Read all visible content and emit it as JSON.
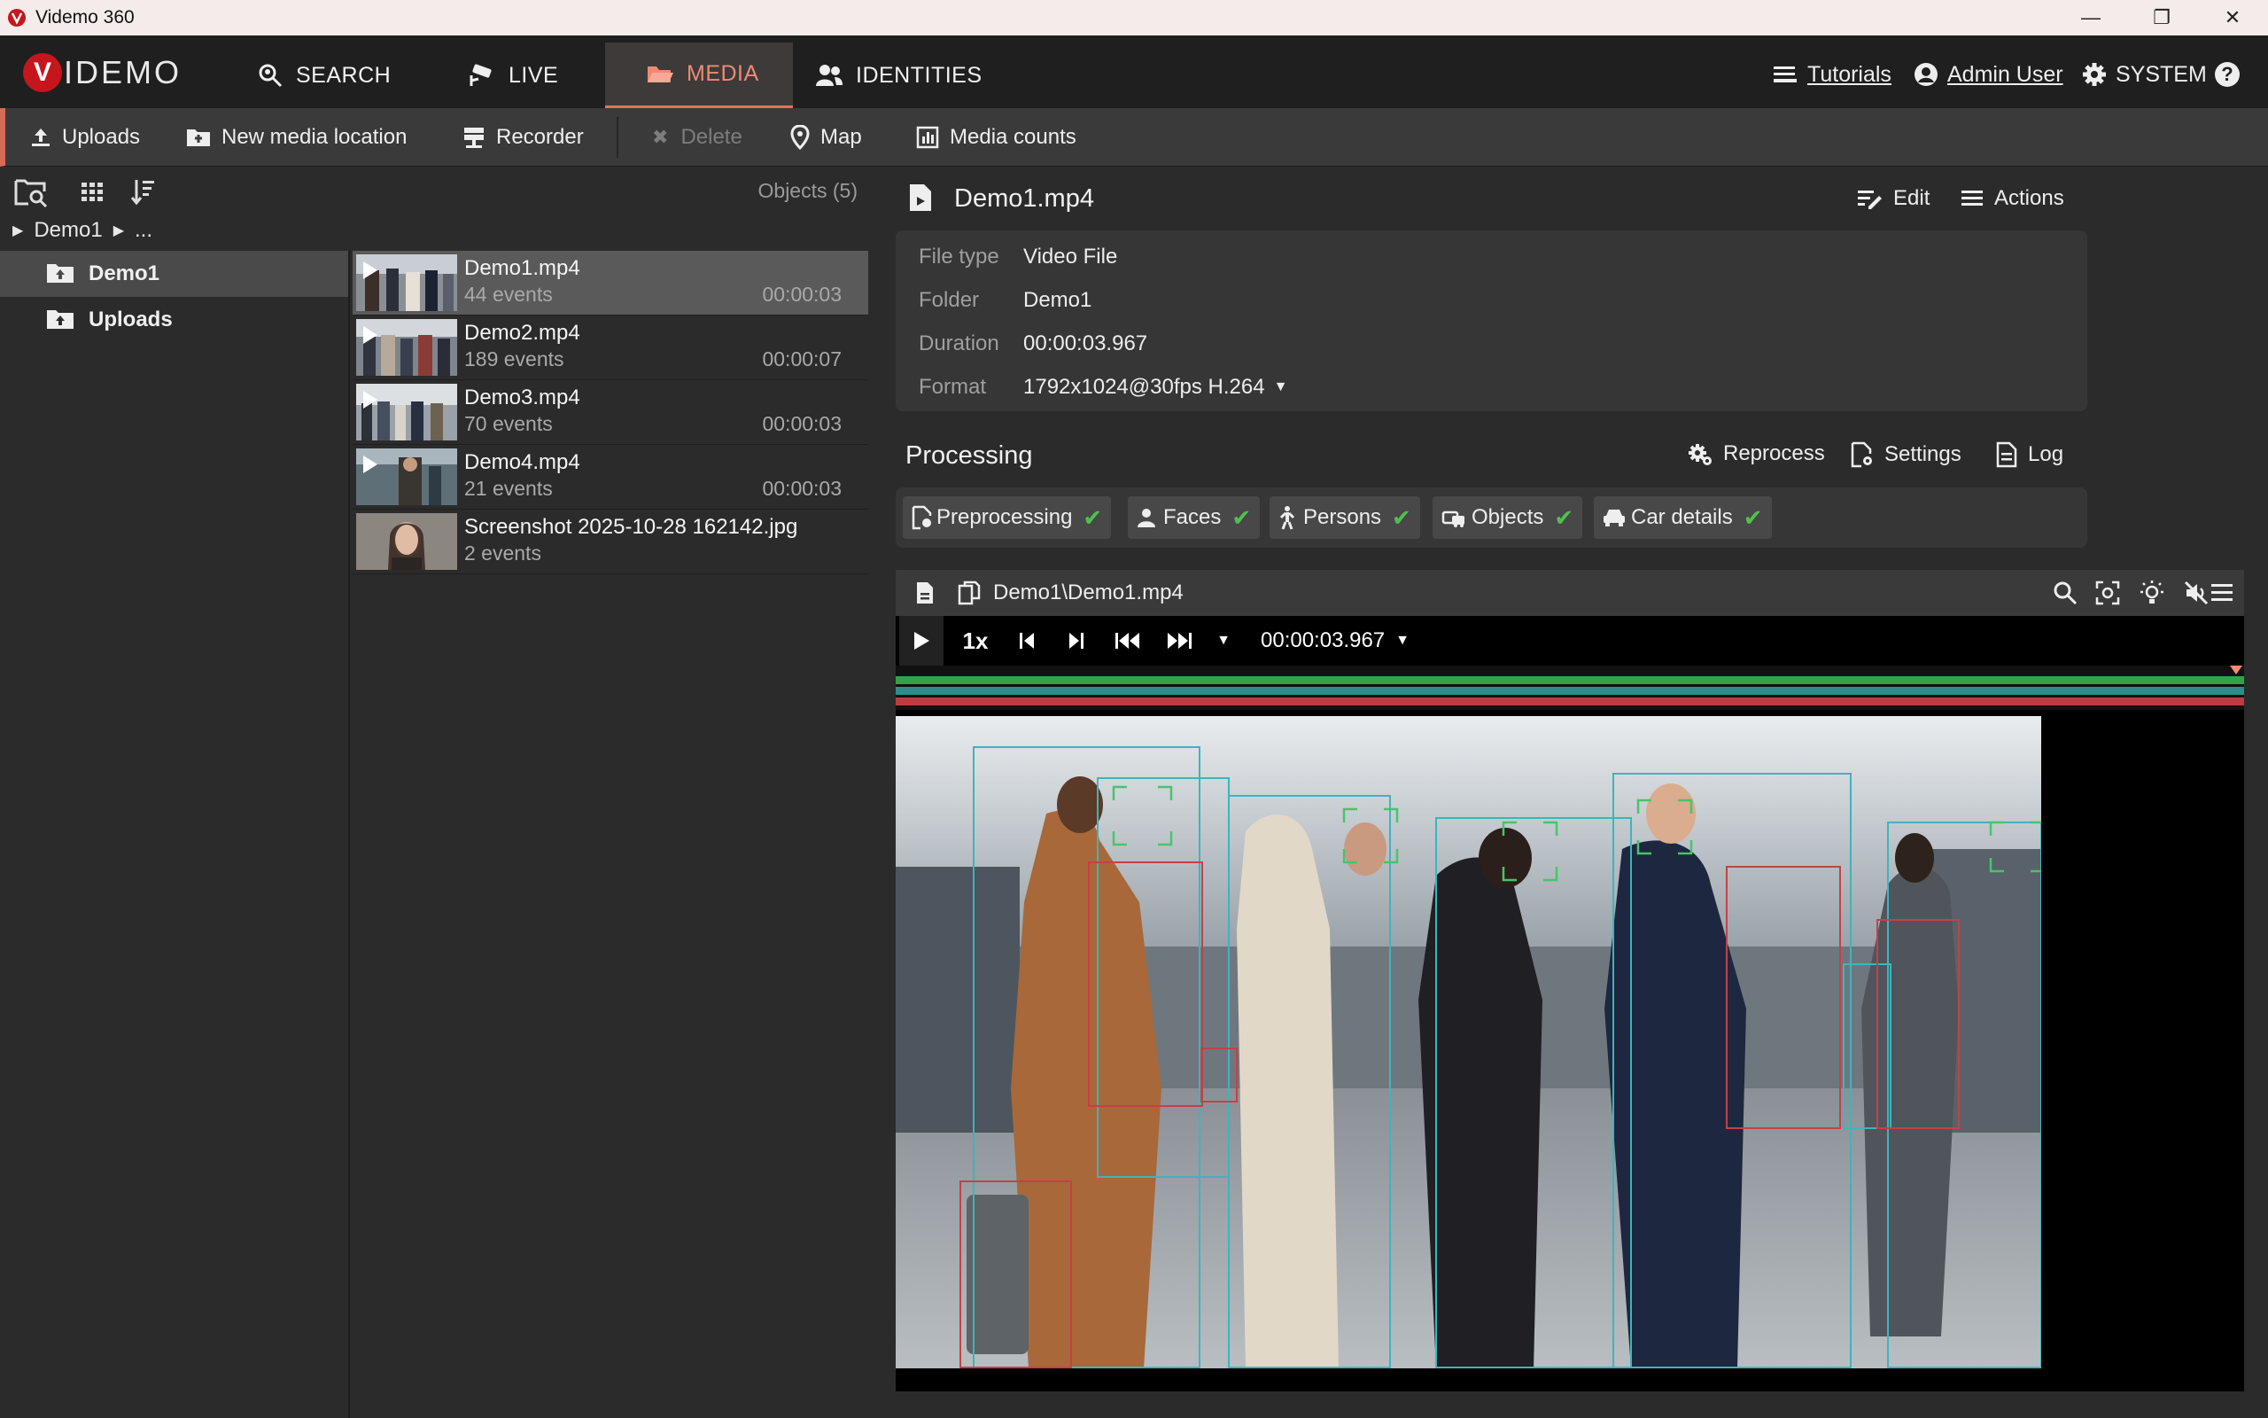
{
  "window": {
    "title": "Videmo 360",
    "minimize": "—",
    "maximize": "❐",
    "close": "✕"
  },
  "nav": {
    "logo_v": "V",
    "logo_rest": "IDEMO",
    "tabs": [
      {
        "label": "SEARCH",
        "icon": "search-face-icon"
      },
      {
        "label": "LIVE",
        "icon": "cctv-camera-icon"
      },
      {
        "label": "MEDIA",
        "icon": "folder-open-icon",
        "active": true
      },
      {
        "label": "IDENTITIES",
        "icon": "people-icon"
      }
    ],
    "tutorials": "Tutorials",
    "user": "Admin User",
    "system": "SYSTEM",
    "help": "?"
  },
  "toolbar": {
    "uploads": "Uploads",
    "new_location": "New media location",
    "recorder": "Recorder",
    "delete": "Delete",
    "map": "Map",
    "media_counts": "Media counts"
  },
  "left": {
    "objects_count": "Objects (5)",
    "breadcrumb_root": "Demo1",
    "breadcrumb_more": "...",
    "tree": [
      {
        "label": "Demo1",
        "selected": true
      },
      {
        "label": "Uploads",
        "selected": false
      }
    ],
    "files": [
      {
        "name": "Demo1.mp4",
        "events": "44 events",
        "duration": "00:00:03"
      },
      {
        "name": "Demo2.mp4",
        "events": "189 events",
        "duration": "00:00:07"
      },
      {
        "name": "Demo3.mp4",
        "events": "70 events",
        "duration": "00:00:03"
      },
      {
        "name": "Demo4.mp4",
        "events": "21 events",
        "duration": "00:00:03"
      },
      {
        "name": "Screenshot 2025-10-28 162142.jpg",
        "events": "2 events",
        "duration": ""
      }
    ]
  },
  "details": {
    "filename": "Demo1.mp4",
    "edit": "Edit",
    "actions": "Actions",
    "props": [
      {
        "label": "File type",
        "value": "Video File"
      },
      {
        "label": "Folder",
        "value": "Demo1"
      },
      {
        "label": "Duration",
        "value": "00:00:03.967"
      },
      {
        "label": "Format",
        "value": "1792x1024@30fps H.264"
      }
    ]
  },
  "processing": {
    "title": "Processing",
    "reprocess": "Reprocess",
    "settings": "Settings",
    "log": "Log",
    "chips": [
      "Preprocessing",
      "Faces",
      "Persons",
      "Objects",
      "Car details"
    ],
    "check": "✔"
  },
  "player": {
    "path": "Demo1\\Demo1.mp4",
    "speed": "1x",
    "timecode": "00:00:03.967",
    "track_colors": [
      "#2fa24a",
      "#2c8e8b",
      "#c03a3f"
    ]
  }
}
